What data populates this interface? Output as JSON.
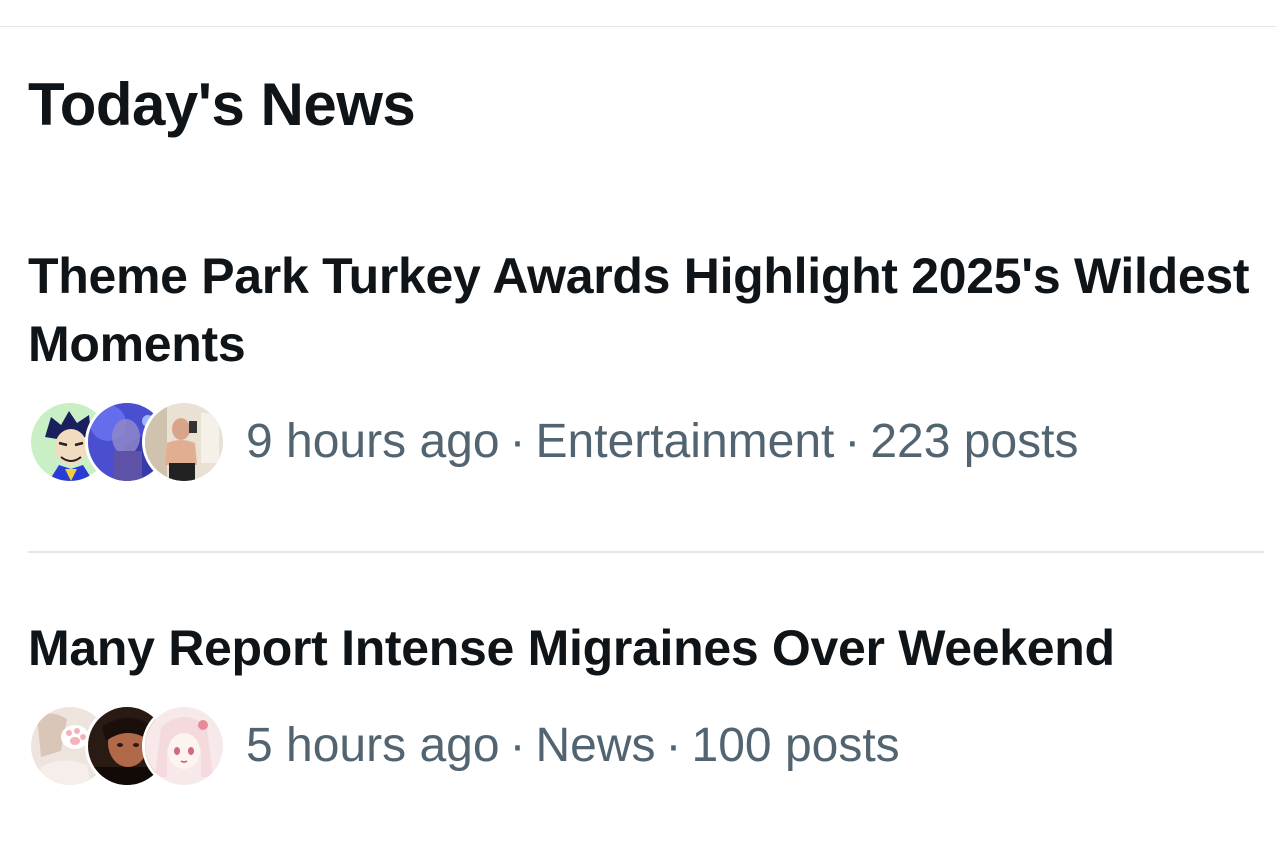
{
  "section": {
    "title": "Today's News"
  },
  "items": [
    {
      "headline": "Theme Park Turkey Awards Highlight 2025's Wildest Moments",
      "time": "9 hours ago",
      "category": "Entertainment",
      "posts": "223 posts",
      "separator": "·",
      "avatars": [
        "cartoon-avatar",
        "blue-blurry-avatar",
        "mirror-selfie-avatar"
      ]
    },
    {
      "headline": "Many Report Intense Migraines Over Weekend",
      "time": "5 hours ago",
      "category": "News",
      "posts": "100 posts",
      "separator": "·",
      "avatars": [
        "anime-paw-avatar",
        "dark-portrait-avatar",
        "anime-girl-avatar"
      ]
    }
  ],
  "colors": {
    "text": "#0f1419",
    "secondary": "#536471",
    "divider": "#e4e7ea"
  }
}
